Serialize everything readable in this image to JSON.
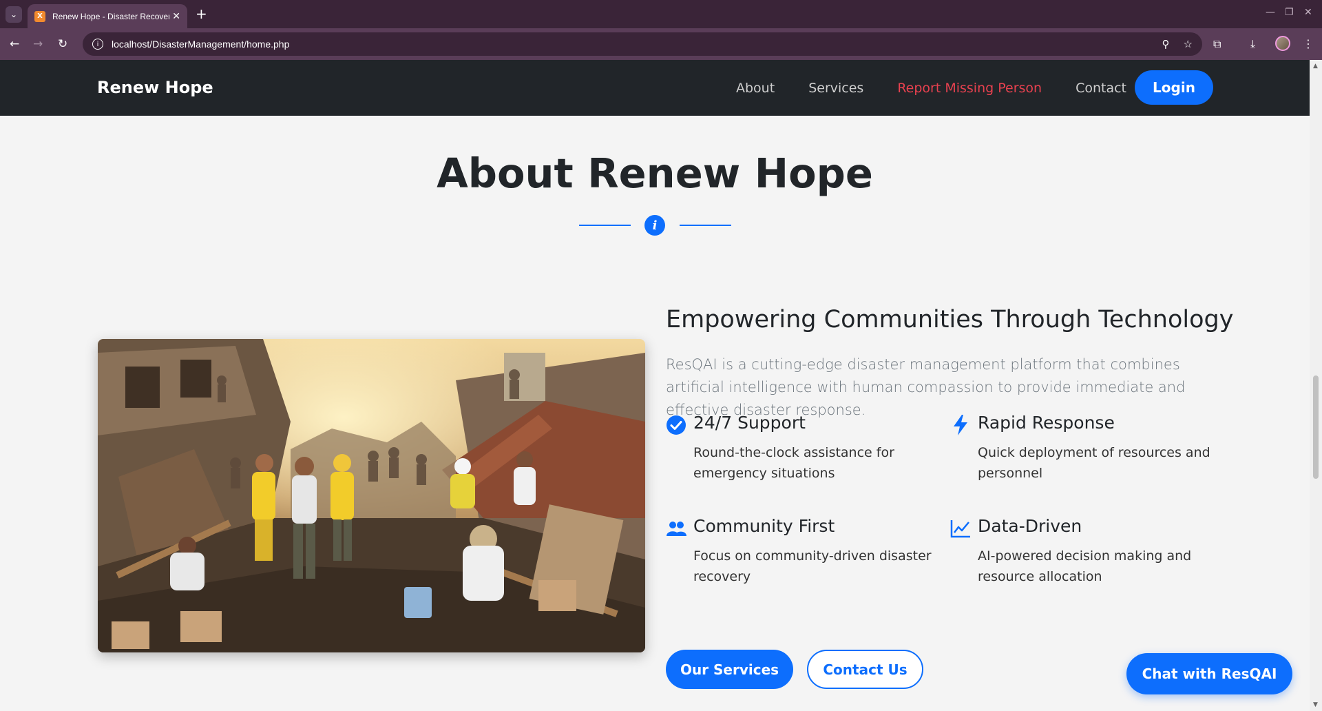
{
  "browser": {
    "tab_title": "Renew Hope - Disaster Recovery",
    "url": "localhost/DisasterManagement/home.php",
    "new_tab": "+",
    "close_tab": "✕"
  },
  "nav": {
    "brand": "Renew Hope",
    "links": [
      "About",
      "Services",
      "Report Missing Person",
      "Contact"
    ],
    "login": "Login"
  },
  "about": {
    "title": "About Renew Hope",
    "subtitle": "Empowering Communities Through Technology",
    "description": "ResQAI is a cutting-edge disaster management platform that combines artificial intelligence with human compassion to provide immediate and effective disaster response.",
    "features": [
      {
        "icon": "check-circle-icon",
        "title": "24/7 Support",
        "text": "Round-the-clock assistance for emergency situations"
      },
      {
        "icon": "bolt-icon",
        "title": "Rapid Response",
        "text": "Quick deployment of resources and personnel"
      },
      {
        "icon": "users-icon",
        "title": "Community First",
        "text": "Focus on community-driven disaster recovery"
      },
      {
        "icon": "chart-line-icon",
        "title": "Data-Driven",
        "text": "AI-powered decision making and resource allocation"
      }
    ],
    "buttons": {
      "primary": "Our Services",
      "secondary": "Contact Us"
    }
  },
  "chat": {
    "label": "Chat with ResQAI"
  },
  "colors": {
    "primary": "#0d6efd",
    "navbar": "#212529",
    "danger": "#e8414f",
    "browser_frame": "#3a2438"
  }
}
